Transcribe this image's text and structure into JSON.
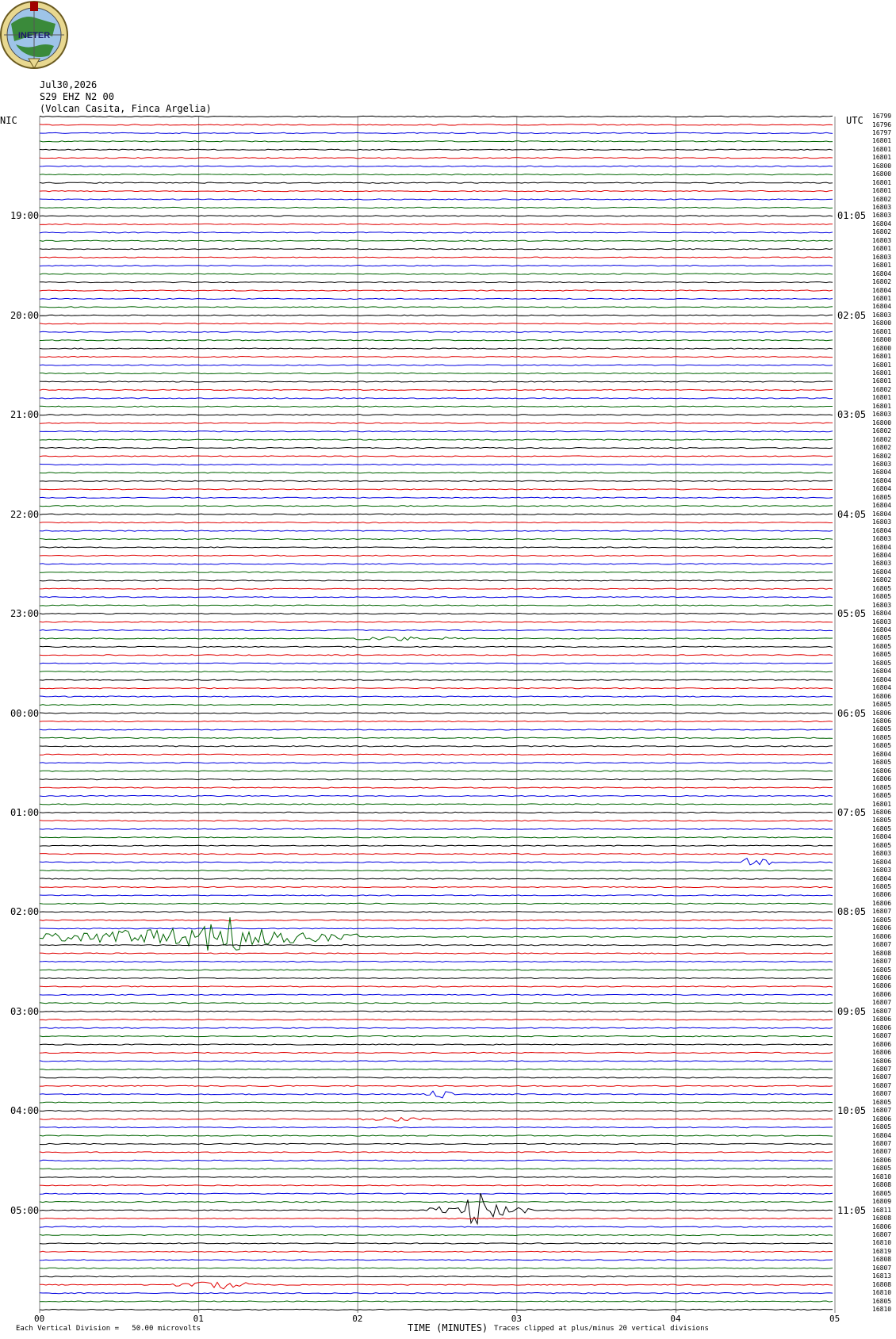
{
  "header": {
    "logo_text": "INETER",
    "date": "Jul30,2026",
    "channel": "S29 EHZ N2 00",
    "station": "(Volcan Casita, Finca Argelia)"
  },
  "axes": {
    "left_tz": "NIC",
    "right_tz": "UTC",
    "left_times": [
      "19:00",
      "20:00",
      "21:00",
      "22:00",
      "23:00",
      "00:00",
      "01:00",
      "02:00",
      "03:00",
      "04:00",
      "05:00"
    ],
    "right_times": [
      "01:05",
      "02:05",
      "03:05",
      "04:05",
      "05:05",
      "06:05",
      "07:05",
      "08:05",
      "09:05",
      "10:05",
      "11:05"
    ],
    "x_ticks": [
      "00",
      "01",
      "02",
      "03",
      "04",
      "05"
    ],
    "x_title": "TIME (MINUTES)"
  },
  "footer": {
    "scale": "Each Vertical Division =   50.00 microvolts",
    "clip": "Traces clipped at plus/minus 20 vertical divisions"
  },
  "colors": {
    "trace_cycle": [
      "#000000",
      "#e00000",
      "#0000e0",
      "#006400"
    ],
    "grid": "#808080"
  },
  "right_counts": [
    "16799",
    "16796",
    "16797",
    "16801",
    "16801",
    "16801",
    "16800",
    "16800",
    "16801",
    "16801",
    "16802",
    "16803",
    "16803",
    "16804",
    "16802",
    "16803",
    "16801",
    "16803",
    "16801",
    "16804",
    "16802",
    "16804",
    "16801",
    "16804",
    "16803",
    "16800",
    "16801",
    "16800",
    "16800",
    "16801",
    "16801",
    "16801",
    "16801",
    "16802",
    "16801",
    "16801",
    "16803",
    "16800",
    "16802",
    "16802",
    "16802",
    "16802",
    "16803",
    "16804",
    "16804",
    "16804",
    "16805",
    "16804",
    "16804",
    "16803",
    "16804",
    "16803",
    "16804",
    "16804",
    "16803",
    "16804",
    "16802",
    "16805",
    "16805",
    "16803",
    "16804",
    "16803",
    "16804",
    "16805",
    "16805",
    "16805",
    "16805",
    "16804",
    "16804",
    "16804",
    "16806",
    "16805",
    "16806",
    "16806",
    "16805",
    "16805",
    "16805",
    "16804",
    "16805",
    "16806",
    "16806",
    "16805",
    "16805",
    "16801",
    "16806",
    "16805",
    "16805",
    "16804",
    "16805",
    "16803",
    "16804",
    "16803",
    "16804",
    "16805",
    "16806",
    "16806",
    "16807",
    "16805",
    "16806",
    "16806",
    "16807",
    "16808",
    "16807",
    "16805",
    "16806",
    "16806",
    "16806",
    "16807",
    "16807",
    "16806",
    "16806",
    "16807",
    "16806",
    "16806",
    "16806",
    "16807",
    "16807",
    "16807",
    "16807",
    "16805",
    "16807",
    "16806",
    "16805",
    "16804",
    "16807",
    "16807",
    "16806",
    "16805",
    "16810",
    "16808",
    "16805",
    "16809",
    "16811",
    "16808",
    "16806",
    "16807",
    "16810",
    "16819",
    "16808",
    "16807",
    "16813",
    "16808",
    "16810",
    "16805",
    "16810"
  ]
}
